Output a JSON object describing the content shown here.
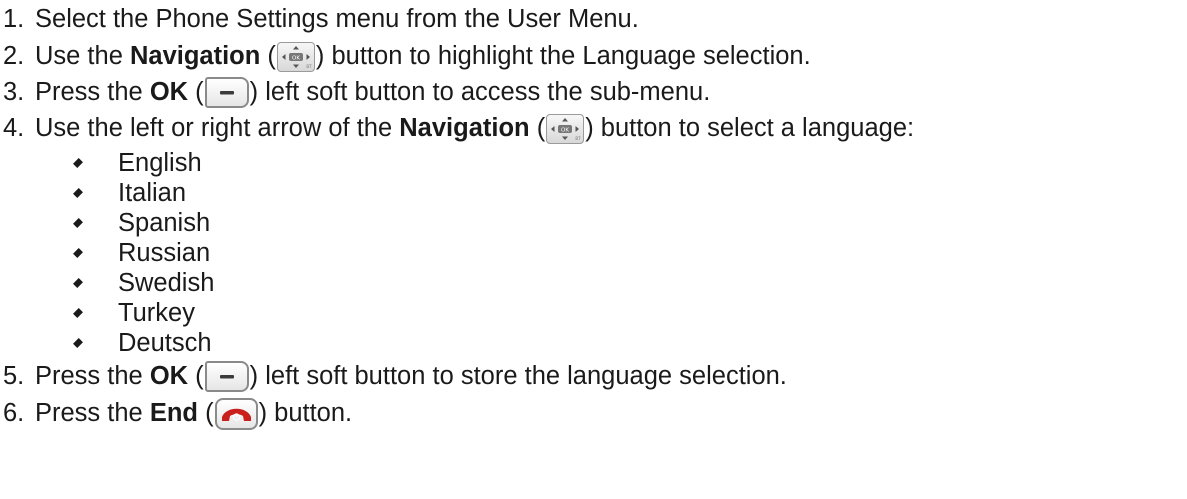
{
  "steps": [
    {
      "number": "1.",
      "text": "Select the Phone Settings menu from the User Menu."
    },
    {
      "number": "2.",
      "pre": "Use the ",
      "bold": "Navigation",
      "open": " (",
      "icon": "navigation-button-icon",
      "post": ") button to highlight the Language selection."
    },
    {
      "number": "3.",
      "pre": "Press the ",
      "bold": "OK",
      "open": " (",
      "icon": "left-soft-button-icon",
      "post": ") left soft button to access the sub-menu."
    },
    {
      "number": "4.",
      "pre": "Use the left or right arrow of the ",
      "bold": "Navigation",
      "open": " (",
      "icon": "navigation-button-icon",
      "post": ") button to select a language:"
    },
    {
      "number": "5.",
      "pre": "Press the ",
      "bold": "OK",
      "open": " (",
      "icon": "left-soft-button-icon",
      "post": ") left soft button to store the language selection."
    },
    {
      "number": "6.",
      "pre": "Press the ",
      "bold": "End",
      "open": " (",
      "icon": "end-call-button-icon",
      "post": ") button."
    }
  ],
  "languages": [
    "English",
    "Italian",
    "Spanish",
    "Russian",
    "Swedish",
    "Turkey",
    "Deutsch"
  ],
  "colors": {
    "text": "#1a1a1a",
    "end_button_red": "#c9201e",
    "icon_border": "#8a8a8a"
  }
}
